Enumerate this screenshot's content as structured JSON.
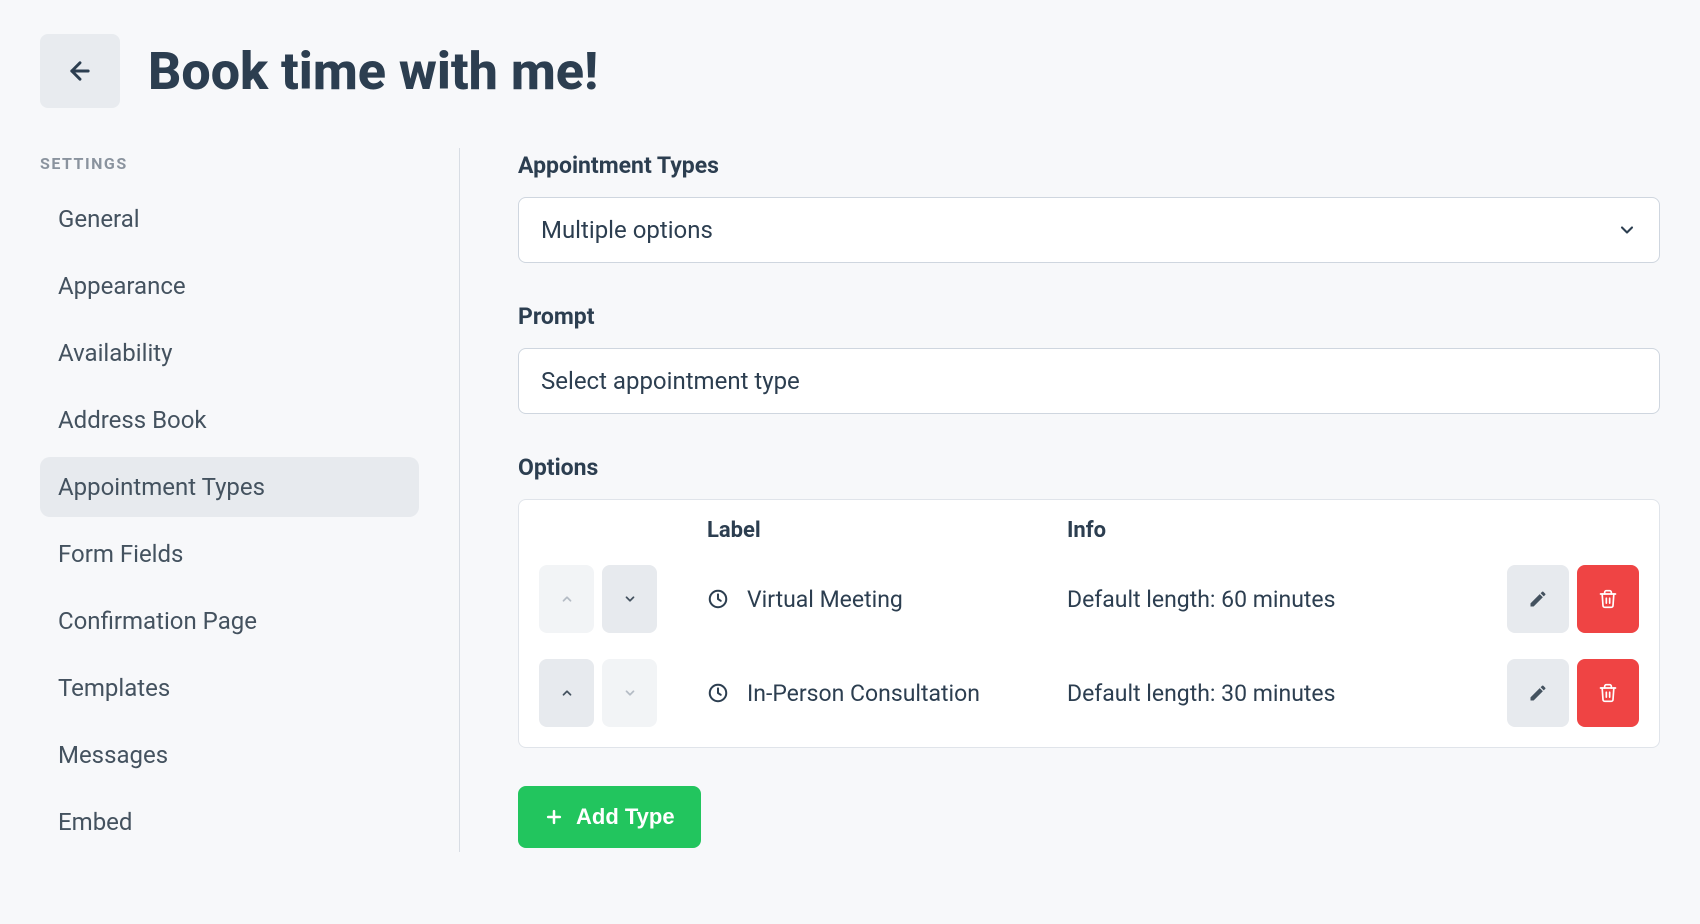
{
  "header": {
    "title": "Book time with me!"
  },
  "sidebar": {
    "heading": "SETTINGS",
    "items": [
      {
        "label": "General"
      },
      {
        "label": "Appearance"
      },
      {
        "label": "Availability"
      },
      {
        "label": "Address Book"
      },
      {
        "label": "Appointment Types",
        "active": true
      },
      {
        "label": "Form Fields"
      },
      {
        "label": "Confirmation Page"
      },
      {
        "label": "Templates"
      },
      {
        "label": "Messages"
      },
      {
        "label": "Embed"
      }
    ]
  },
  "main": {
    "appointment_types_label": "Appointment Types",
    "appointment_types_value": "Multiple options",
    "prompt_label": "Prompt",
    "prompt_value": "Select appointment type",
    "options_label": "Options",
    "table": {
      "col_label": "Label",
      "col_info": "Info",
      "rows": [
        {
          "label": "Virtual Meeting",
          "info": "Default length: 60 minutes",
          "up_enabled": false,
          "down_enabled": true
        },
        {
          "label": "In-Person Consultation",
          "info": "Default length: 30 minutes",
          "up_enabled": true,
          "down_enabled": false
        }
      ]
    },
    "add_button_label": "Add Type"
  },
  "icons": {
    "back": "arrow-left-icon",
    "chevron_down": "chevron-down-icon",
    "chevron_up_small": "chevron-up-small-icon",
    "chevron_down_small": "chevron-down-small-icon",
    "clock": "clock-icon",
    "pencil": "pencil-icon",
    "trash": "trash-icon",
    "plus": "plus-icon"
  }
}
